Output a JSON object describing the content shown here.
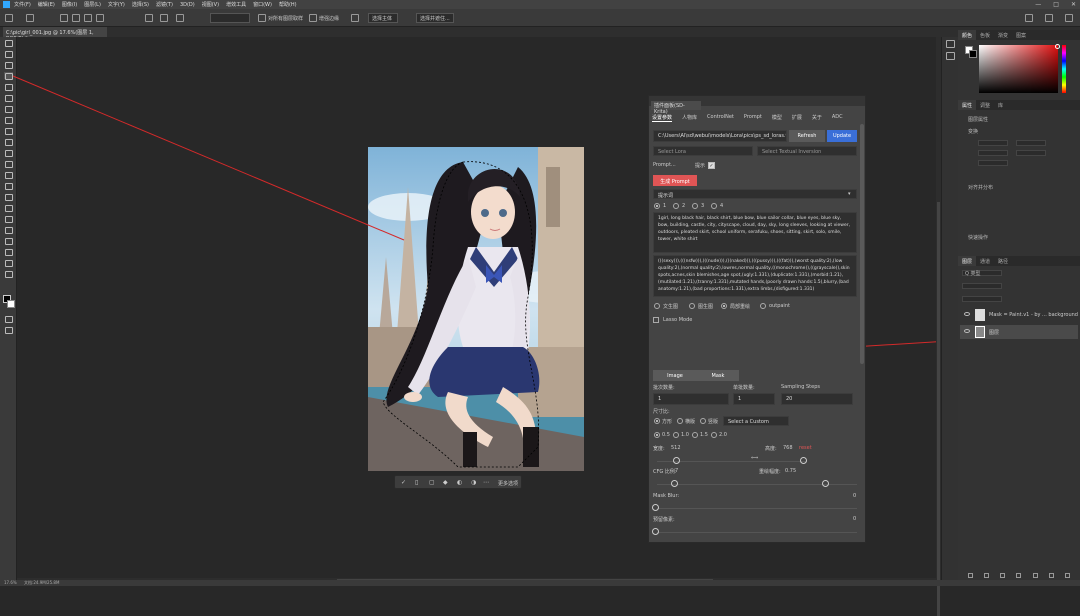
{
  "menubar": {
    "items": [
      "文件(F)",
      "编辑(E)",
      "图像(I)",
      "图层(L)",
      "文字(Y)",
      "选择(S)",
      "滤镜(T)",
      "3D(D)",
      "视图(V)",
      "增效工具",
      "窗口(W)",
      "帮助(H)"
    ]
  },
  "optbar": {
    "sample_all": "对所有图层取样",
    "enhance_edge": "增强边缘",
    "select_subject": "选择主体",
    "select_and_mask": "选择并遮住..."
  },
  "document": {
    "tab_label": "C:\\pic\\girl_001.jpg @ 17.6%(图层 1, RGB/8) *"
  },
  "status": {
    "zoom": "17.6%",
    "doc_info": "文档:24.9M/25.8M"
  },
  "context_bar": {
    "more_label": "更多选项"
  },
  "right_panels": {
    "color_tabs": [
      "颜色",
      "色板",
      "渐变",
      "图案"
    ],
    "properties_tabs": [
      "属性",
      "调整",
      "库"
    ],
    "properties_title": "图层属性",
    "transform_label": "变换",
    "align_label": "对齐并分布",
    "quick_actions_label": "快速操作",
    "layers_tabs": [
      "图层",
      "通道",
      "路径"
    ],
    "layer_filter_label": "Q 类型",
    "layers": [
      {
        "name": "Mask = Paint.v1 - by ... background"
      },
      {
        "name": "图层"
      }
    ],
    "accent_color": "#31a8ff"
  },
  "plugin": {
    "title": "插件面板(SD-Krita)",
    "tabs": [
      "设置参数",
      "人物库",
      "ControlNet",
      "Prompt",
      "模型",
      "扩展",
      "关于",
      "ADC"
    ],
    "path_value": "C:\\Users\\AI\\sd\\webui\\models\\Lora\\pics\\ps_sd_loras.txt",
    "refresh_label": "Refresh",
    "update_label": "Update",
    "select_lora_placeholder": "Select Lora",
    "select_textual_placeholder": "Select Textual Inversion",
    "prompt_label": "Prompt...",
    "prompt_hint": "提示",
    "generate_label": "生成 Prompt",
    "model_dropdown": "提示词",
    "slots": [
      "1",
      "2",
      "3",
      "4"
    ],
    "prompt_text": "1girl, long black hair, black shirt, blue bow, blue sailor collar, blue eyes, blue sky, bow, building, castle, city, cityscape, cloud, day, sky, long sleeves, looking at viewer, outdoors, pleated skirt, school uniform, serafuku, shoes, sitting, skirt, solo, smile, tower, white shirt",
    "neg_prompt_text": "(((sexy))),(((nsfw))),(((nude))),(((naked))),(((pussy))),(((fat))),(worst quality:2),(low quality:2),(normal quality:2),lowres,normal quality,((monochrome)),((grayscale)),skin spots,acnes,skin blemishes,age spot,(ugly:1.331),(duplicate:1.331),(morbid:1.21),(mutilated:1.21),(tranny:1.331),mutated hands,(poorly drawn hands:1.5),blurry,(bad anatomy:1.21),(bad proportions:1.331),extra limbs,(disfigured:1.331)",
    "mode_options": [
      "文生图",
      "图生图",
      "局部重绘",
      "outpaint"
    ],
    "mode_selected": 2,
    "lasso_label": "Lasso Mode",
    "image_label": "Image",
    "mask_label": "Mask",
    "batch_size_label": "批次数量:",
    "batch_count_label": "单批数量:",
    "steps_label": "Sampling Steps",
    "batch_size": "1",
    "batch_count": "1",
    "steps": "20",
    "size_label": "尺寸比:",
    "orient_options": [
      "方形",
      "横版",
      "竖版"
    ],
    "preset_label": "Select a Custom Preset",
    "scale_options": [
      "0.5",
      "1.0",
      "1.5",
      "2.0"
    ],
    "width_label": "宽度:",
    "width_value": "512",
    "height_label": "高度:",
    "height_value": "768",
    "height_reset": "reset",
    "cfg_label": "CFG 比例:",
    "cfg_value": "7",
    "denoise_label": "重绘幅度:",
    "denoise_value": "0.75",
    "mask_blur_label": "Mask Blur:",
    "mask_blur_value": "0",
    "extra_label": "预留像素:",
    "extra_value": "0",
    "generate_btn_color": "#e05555",
    "refresh_btn_color": "#5a5a5a",
    "update_btn_color": "#3a6fd8"
  }
}
